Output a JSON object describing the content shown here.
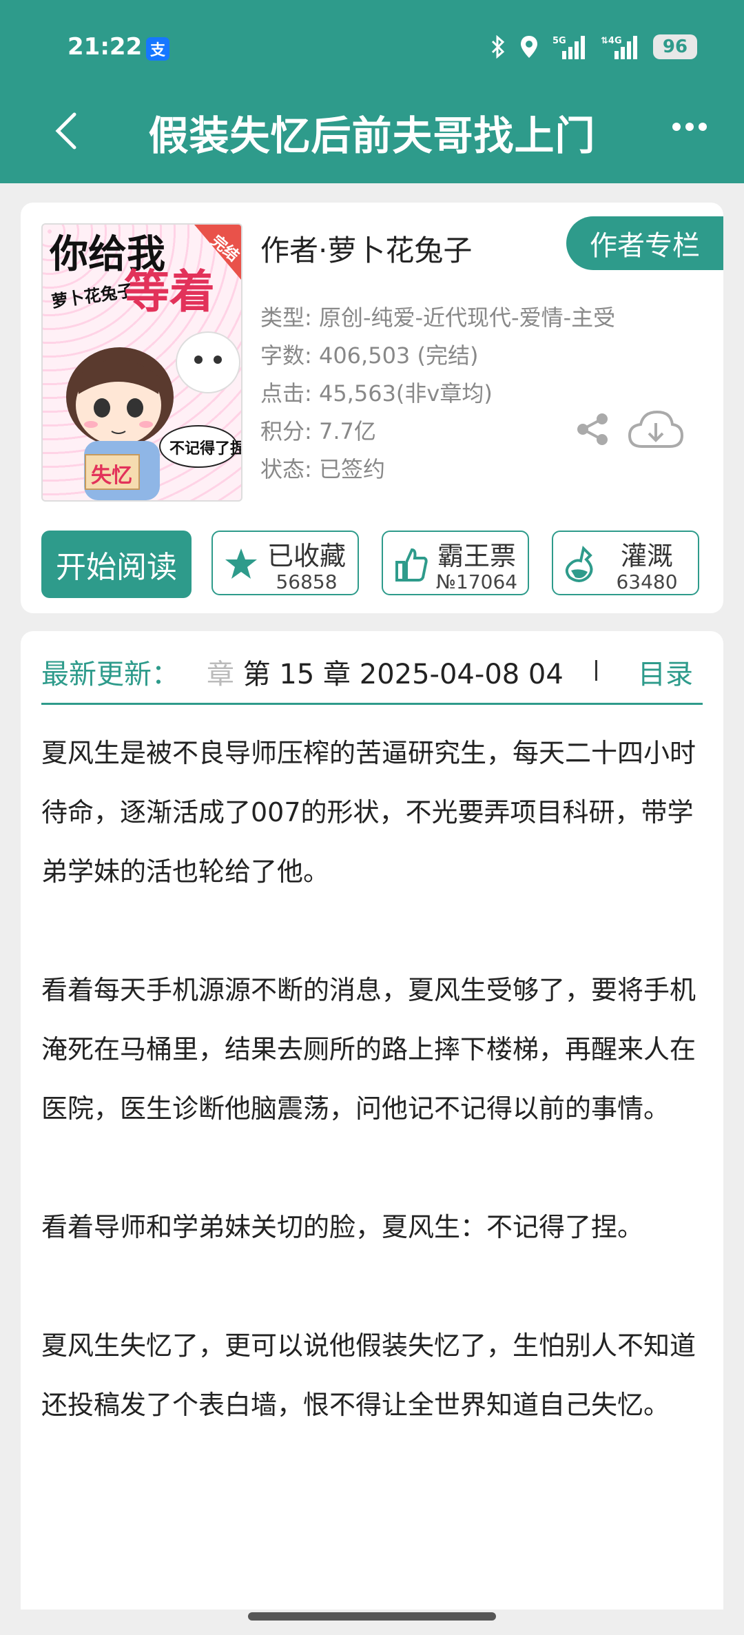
{
  "status_bar": {
    "time": "21:22",
    "battery": "96"
  },
  "header": {
    "title": "假装失忆后前夫哥找上门"
  },
  "book": {
    "cover": {
      "title_top": "你给我",
      "title_bottom": "等着",
      "author_tag": "萝卜花兔子",
      "complete_tag": "完结",
      "bubble_text": "不记得了捏",
      "sign_text": "失忆"
    },
    "author_line": "作者·萝卜花兔子",
    "author_column_label": "作者专栏",
    "info": [
      "类型: 原创-纯爱-近代现代-爱情-主受",
      "字数: 406,503 (完结)",
      "点击: 45,563(非v章均)",
      "积分: 7.7亿",
      "状态: 已签约"
    ],
    "actions": {
      "read_label": "开始阅读",
      "favorite": {
        "label": "已收藏",
        "count": "56858"
      },
      "ticket": {
        "label": "霸王票",
        "count": "№17064"
      },
      "nutrient": {
        "label": "灌溉",
        "count": "63480"
      }
    }
  },
  "latest": {
    "label": "最新更新：",
    "faded_char": "章",
    "text": " 第 15 章  2025-04-08 04",
    "toc_label": "目录"
  },
  "synopsis": [
    "夏风生是被不良导师压榨的苦逼研究生，每天二十四小时待命，逐渐活成了007的形状，不光要弄项目科研，带学弟学妹的活也轮给了他。",
    "看着每天手机源源不断的消息，夏风生受够了，要将手机淹死在马桶里，结果去厕所的路上摔下楼梯，再醒来人在医院，医生诊断他脑震荡，问他记不记得以前的事情。",
    "看着导师和学弟妹关切的脸，夏风生：不记得了捏。",
    "夏风生失忆了，更可以说他假装失忆了，生怕别人不知道还投稿发了个表白墙，恨不得让全世界知道自己失忆。"
  ],
  "colors": {
    "accent": "#2e9b8b",
    "background": "#eeeeee"
  }
}
